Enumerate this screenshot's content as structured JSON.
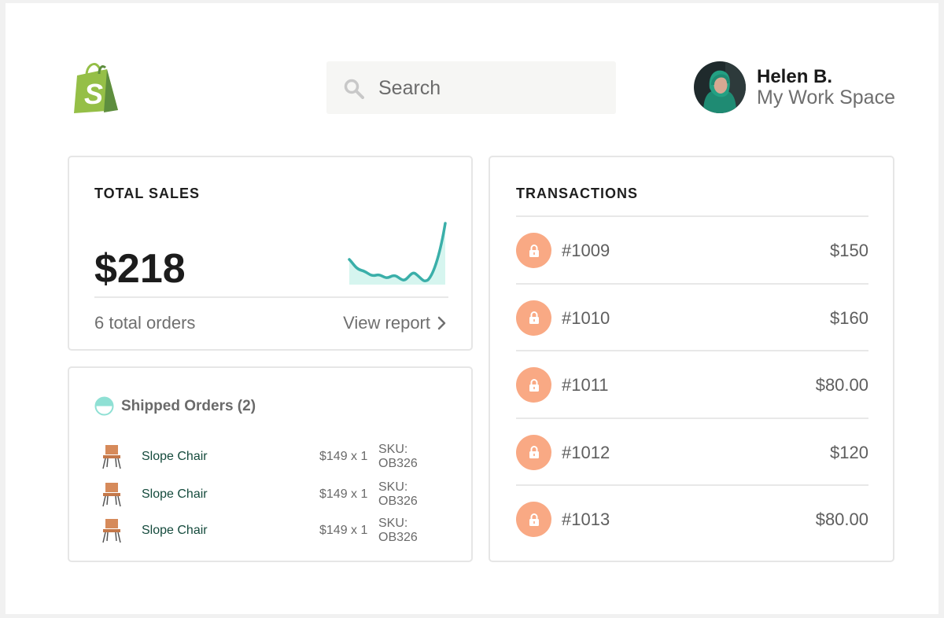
{
  "header": {
    "search": {
      "placeholder": "Search"
    },
    "user": {
      "name": "Helen B.",
      "workspace": "My Work Space"
    }
  },
  "total_sales": {
    "title": "TOTAL SALES",
    "amount": "$218",
    "orders": "6 total orders",
    "view_report": "View report"
  },
  "shipped_orders": {
    "title": "Shipped Orders (2)",
    "items": [
      {
        "name": "Slope Chair",
        "price": "$149 x 1",
        "sku": "SKU: OB326"
      },
      {
        "name": "Slope Chair",
        "price": "$149 x 1",
        "sku": "SKU: OB326"
      },
      {
        "name": "Slope Chair",
        "price": "$149 x 1",
        "sku": "SKU: OB326"
      }
    ]
  },
  "transactions": {
    "title": "TRANSACTIONS",
    "rows": [
      {
        "id": "#1009",
        "amount": "$150"
      },
      {
        "id": "#1010",
        "amount": "$160"
      },
      {
        "id": "#1011",
        "amount": "$80.00"
      },
      {
        "id": "#1012",
        "amount": "$120"
      },
      {
        "id": "#1013",
        "amount": "$80.00"
      }
    ]
  },
  "colors": {
    "brand_green": "#95bf47",
    "teal": "#3aafa9",
    "lock_orange": "#f9a984",
    "product_link": "#144a3c"
  },
  "icons": {
    "logo": "shopify-bag-icon",
    "search": "search-icon",
    "chevron": "chevron-right-icon",
    "status": "half-circle-icon",
    "product": "chair-icon",
    "transaction": "lock-icon"
  }
}
